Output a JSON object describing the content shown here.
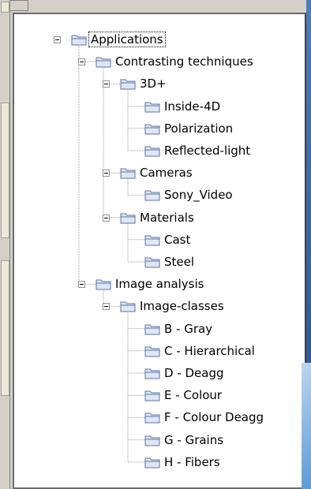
{
  "tree": {
    "nodes": [
      {
        "label": "Applications",
        "depth": 0,
        "expanded": true,
        "selected": true
      },
      {
        "label": "Contrasting techniques",
        "depth": 1,
        "expanded": true
      },
      {
        "label": "3D+",
        "depth": 2,
        "expanded": true
      },
      {
        "label": "Inside-4D",
        "depth": 3
      },
      {
        "label": "Polarization",
        "depth": 3
      },
      {
        "label": "Reflected-light",
        "depth": 3
      },
      {
        "label": "Cameras",
        "depth": 2,
        "expanded": true
      },
      {
        "label": "Sony_Video",
        "depth": 3
      },
      {
        "label": "Materials",
        "depth": 2,
        "expanded": true
      },
      {
        "label": "Cast",
        "depth": 3
      },
      {
        "label": "Steel",
        "depth": 3
      },
      {
        "label": "Image analysis",
        "depth": 1,
        "expanded": true
      },
      {
        "label": "Image-classes",
        "depth": 2,
        "expanded": true
      },
      {
        "label": "B - Gray",
        "depth": 3
      },
      {
        "label": "C - Hierarchical",
        "depth": 3
      },
      {
        "label": "D - Deagg",
        "depth": 3
      },
      {
        "label": "E - Colour",
        "depth": 3
      },
      {
        "label": "F - Colour Deagg",
        "depth": 3
      },
      {
        "label": "G - Grains",
        "depth": 3
      },
      {
        "label": "H - Fibers",
        "depth": 3
      }
    ]
  },
  "icons": {
    "folder": "folder-icon",
    "expand_toggle": "minus-icon"
  },
  "colors": {
    "folder_fill": "#dfe6f5",
    "folder_stroke": "#5b74a6",
    "tree_line": "#9a9a9a",
    "panel_bg": "#ffffff",
    "window_bg": "#d4d0c8"
  }
}
